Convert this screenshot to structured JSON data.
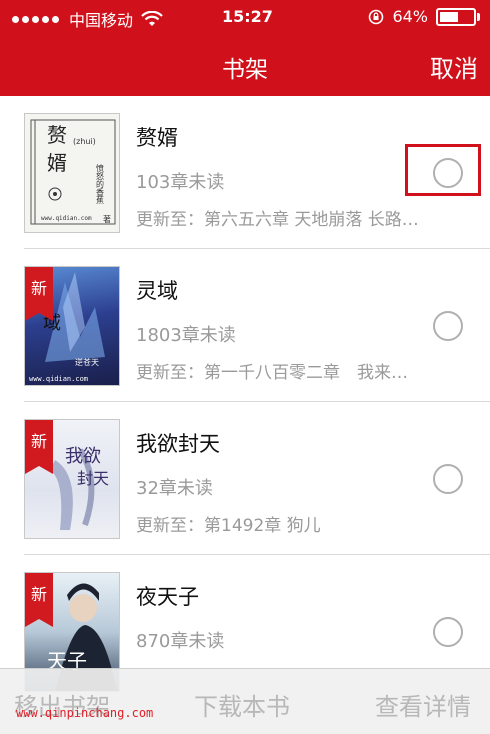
{
  "status_bar": {
    "carrier": "中国移动",
    "time": "15:27",
    "battery": "64%",
    "battery_level": 0.64
  },
  "header": {
    "title": "书架",
    "cancel_label": "取消"
  },
  "books": [
    {
      "title": "赘婿",
      "unread": "103章未读",
      "update": "更新至：第六五六章 天地崩落 长路…",
      "is_new": false,
      "cover_text": [
        "赘",
        "婿",
        "(zhui)",
        "愤怒的香蕉",
        "www.qidian.com",
        "著"
      ]
    },
    {
      "title": "灵域",
      "unread": "1803章未读",
      "update": "更新至：第一千八百零二章　我来…",
      "is_new": true,
      "cover_text": [
        "域",
        "逆苍天",
        "www.qidian.com"
      ]
    },
    {
      "title": "我欲封天",
      "unread": "32章未读",
      "update": "更新至：第1492章 狗儿",
      "is_new": true,
      "cover_text": [
        "我欲",
        "封天"
      ]
    },
    {
      "title": "夜天子",
      "unread": "870章未读",
      "update": "",
      "is_new": true,
      "cover_text": [
        "天子"
      ]
    }
  ],
  "badge_label": "新",
  "toolbar": {
    "remove_label": "移出书架",
    "download_label": "下载本书",
    "detail_label": "查看详情"
  },
  "watermark": "www.qinpinchang.com",
  "colors": {
    "accent": "#d0101a",
    "muted_text": "#9a9a9a"
  }
}
